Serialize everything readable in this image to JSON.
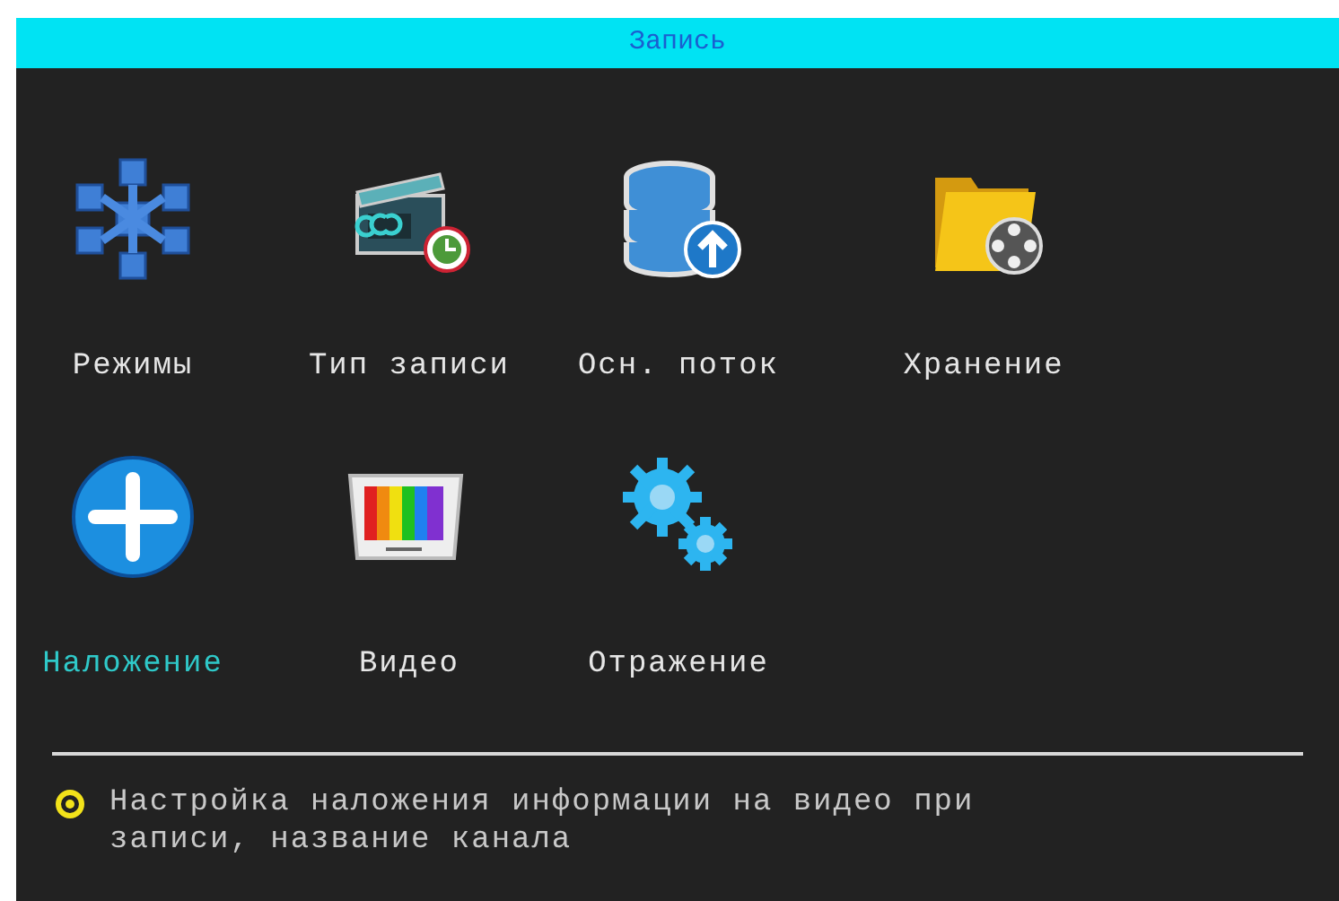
{
  "window": {
    "title": "Запись"
  },
  "items": [
    {
      "label": "Режимы",
      "selected": false
    },
    {
      "label": "Тип записи",
      "selected": false
    },
    {
      "label": "Осн. поток",
      "selected": false
    },
    {
      "label": "Хранение",
      "selected": false
    },
    {
      "label": "Наложение",
      "selected": true
    },
    {
      "label": "Видео",
      "selected": false
    },
    {
      "label": "Отражение",
      "selected": false
    }
  ],
  "hint": "Настройка наложения информации на видео при записи, название канала"
}
